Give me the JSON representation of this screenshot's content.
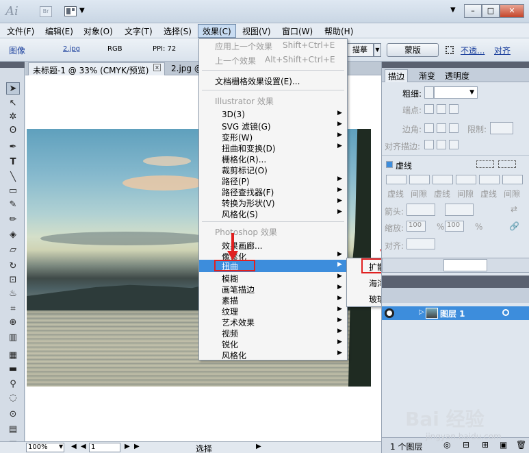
{
  "title_bar": {
    "app_logo": "Ai",
    "bridge_label": "Br"
  },
  "menubar": {
    "items": [
      "文件(F)",
      "编辑(E)",
      "对象(O)",
      "文字(T)",
      "选择(S)",
      "效果(C)",
      "视图(V)",
      "窗口(W)",
      "帮助(H)"
    ]
  },
  "control_bar": {
    "image_label": "图像",
    "file_name": "2.jpg",
    "color_mode": "RGB",
    "ppi": "PPI: 72",
    "tracing_label": "描摹",
    "mask_button": "蒙版",
    "opacity_label": "不透...",
    "align_label": "对齐"
  },
  "document_tabs": [
    {
      "label": "未标题-1 @ 33% (CMYK/预览)"
    },
    {
      "label": "2.jpg @"
    }
  ],
  "effect_menu": {
    "apply_last": "应用上一个效果",
    "apply_last_shortcut": "Shift+Ctrl+E",
    "last_effect": "上一个效果",
    "last_effect_shortcut": "Alt+Shift+Ctrl+E",
    "doc_raster_settings": "文档栅格效果设置(E)...",
    "illustrator_section": "Illustrator 效果",
    "illustrator_items": [
      "3D(3)",
      "SVG 滤镜(G)",
      "变形(W)",
      "扭曲和变换(D)",
      "栅格化(R)...",
      "裁剪标记(O)",
      "路径(P)",
      "路径查找器(F)",
      "转换为形状(V)",
      "风格化(S)"
    ],
    "photoshop_section": "Photoshop 效果",
    "photoshop_items": [
      "效果画廊...",
      "像素化",
      "扭曲",
      "模糊",
      "画笔描边",
      "素描",
      "纹理",
      "艺术效果",
      "视频",
      "锐化",
      "风格化"
    ]
  },
  "distort_submenu": {
    "items": [
      "扩散亮光...",
      "海洋波纹...",
      "玻璃..."
    ]
  },
  "right_panel": {
    "tabs": [
      "描边",
      "渐变",
      "透明度"
    ],
    "weight_label": "粗细:",
    "cap_label": "端点:",
    "corner_label": "边角:",
    "limit_label": "限制:",
    "align_stroke_label": "对齐描边:",
    "dashed_label": "虚线",
    "dash_gap_labels": [
      "虚线",
      "间隙",
      "虚线",
      "间隙",
      "虚线",
      "间隙"
    ],
    "arrowheads_label": "箭头:",
    "scale_label": "缩放:",
    "scale_value_1": "100",
    "scale_value_2": "100",
    "percent_1": "%",
    "percent_2": "%",
    "align_label": "对齐:"
  },
  "layers_panel": {
    "layer_name": "图层 1",
    "layer_count": "1 个图层"
  },
  "status_bar": {
    "zoom": "100%",
    "page": "1",
    "status": "选择"
  },
  "watermark": {
    "line1": "Bai 经验",
    "line2": "jingyan.baidu.com"
  },
  "colors": {
    "menu_highlight": "#3d8ddc",
    "callout_red": "#e02020",
    "panel_bg": "#dfe6ee"
  }
}
